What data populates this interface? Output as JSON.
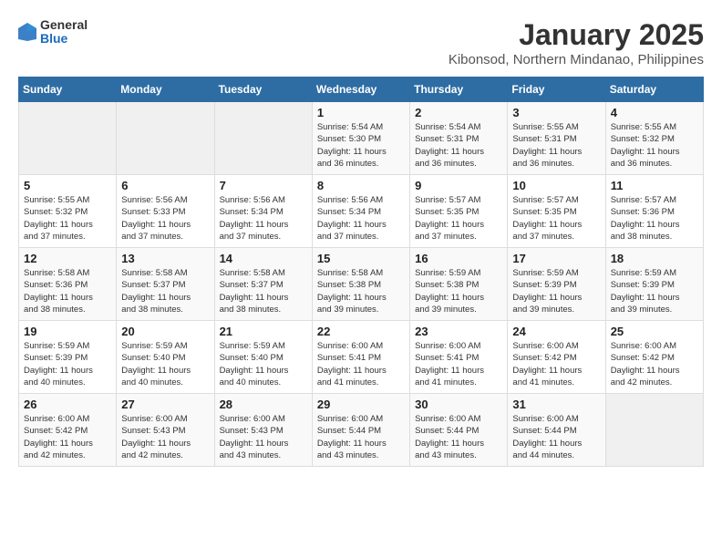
{
  "logo": {
    "general": "General",
    "blue": "Blue"
  },
  "title": "January 2025",
  "subtitle": "Kibonsod, Northern Mindanao, Philippines",
  "weekdays": [
    "Sunday",
    "Monday",
    "Tuesday",
    "Wednesday",
    "Thursday",
    "Friday",
    "Saturday"
  ],
  "weeks": [
    [
      {
        "day": "",
        "info": ""
      },
      {
        "day": "",
        "info": ""
      },
      {
        "day": "",
        "info": ""
      },
      {
        "day": "1",
        "info": "Sunrise: 5:54 AM\nSunset: 5:30 PM\nDaylight: 11 hours\nand 36 minutes."
      },
      {
        "day": "2",
        "info": "Sunrise: 5:54 AM\nSunset: 5:31 PM\nDaylight: 11 hours\nand 36 minutes."
      },
      {
        "day": "3",
        "info": "Sunrise: 5:55 AM\nSunset: 5:31 PM\nDaylight: 11 hours\nand 36 minutes."
      },
      {
        "day": "4",
        "info": "Sunrise: 5:55 AM\nSunset: 5:32 PM\nDaylight: 11 hours\nand 36 minutes."
      }
    ],
    [
      {
        "day": "5",
        "info": "Sunrise: 5:55 AM\nSunset: 5:32 PM\nDaylight: 11 hours\nand 37 minutes."
      },
      {
        "day": "6",
        "info": "Sunrise: 5:56 AM\nSunset: 5:33 PM\nDaylight: 11 hours\nand 37 minutes."
      },
      {
        "day": "7",
        "info": "Sunrise: 5:56 AM\nSunset: 5:34 PM\nDaylight: 11 hours\nand 37 minutes."
      },
      {
        "day": "8",
        "info": "Sunrise: 5:56 AM\nSunset: 5:34 PM\nDaylight: 11 hours\nand 37 minutes."
      },
      {
        "day": "9",
        "info": "Sunrise: 5:57 AM\nSunset: 5:35 PM\nDaylight: 11 hours\nand 37 minutes."
      },
      {
        "day": "10",
        "info": "Sunrise: 5:57 AM\nSunset: 5:35 PM\nDaylight: 11 hours\nand 37 minutes."
      },
      {
        "day": "11",
        "info": "Sunrise: 5:57 AM\nSunset: 5:36 PM\nDaylight: 11 hours\nand 38 minutes."
      }
    ],
    [
      {
        "day": "12",
        "info": "Sunrise: 5:58 AM\nSunset: 5:36 PM\nDaylight: 11 hours\nand 38 minutes."
      },
      {
        "day": "13",
        "info": "Sunrise: 5:58 AM\nSunset: 5:37 PM\nDaylight: 11 hours\nand 38 minutes."
      },
      {
        "day": "14",
        "info": "Sunrise: 5:58 AM\nSunset: 5:37 PM\nDaylight: 11 hours\nand 38 minutes."
      },
      {
        "day": "15",
        "info": "Sunrise: 5:58 AM\nSunset: 5:38 PM\nDaylight: 11 hours\nand 39 minutes."
      },
      {
        "day": "16",
        "info": "Sunrise: 5:59 AM\nSunset: 5:38 PM\nDaylight: 11 hours\nand 39 minutes."
      },
      {
        "day": "17",
        "info": "Sunrise: 5:59 AM\nSunset: 5:39 PM\nDaylight: 11 hours\nand 39 minutes."
      },
      {
        "day": "18",
        "info": "Sunrise: 5:59 AM\nSunset: 5:39 PM\nDaylight: 11 hours\nand 39 minutes."
      }
    ],
    [
      {
        "day": "19",
        "info": "Sunrise: 5:59 AM\nSunset: 5:39 PM\nDaylight: 11 hours\nand 40 minutes."
      },
      {
        "day": "20",
        "info": "Sunrise: 5:59 AM\nSunset: 5:40 PM\nDaylight: 11 hours\nand 40 minutes."
      },
      {
        "day": "21",
        "info": "Sunrise: 5:59 AM\nSunset: 5:40 PM\nDaylight: 11 hours\nand 40 minutes."
      },
      {
        "day": "22",
        "info": "Sunrise: 6:00 AM\nSunset: 5:41 PM\nDaylight: 11 hours\nand 41 minutes."
      },
      {
        "day": "23",
        "info": "Sunrise: 6:00 AM\nSunset: 5:41 PM\nDaylight: 11 hours\nand 41 minutes."
      },
      {
        "day": "24",
        "info": "Sunrise: 6:00 AM\nSunset: 5:42 PM\nDaylight: 11 hours\nand 41 minutes."
      },
      {
        "day": "25",
        "info": "Sunrise: 6:00 AM\nSunset: 5:42 PM\nDaylight: 11 hours\nand 42 minutes."
      }
    ],
    [
      {
        "day": "26",
        "info": "Sunrise: 6:00 AM\nSunset: 5:42 PM\nDaylight: 11 hours\nand 42 minutes."
      },
      {
        "day": "27",
        "info": "Sunrise: 6:00 AM\nSunset: 5:43 PM\nDaylight: 11 hours\nand 42 minutes."
      },
      {
        "day": "28",
        "info": "Sunrise: 6:00 AM\nSunset: 5:43 PM\nDaylight: 11 hours\nand 43 minutes."
      },
      {
        "day": "29",
        "info": "Sunrise: 6:00 AM\nSunset: 5:44 PM\nDaylight: 11 hours\nand 43 minutes."
      },
      {
        "day": "30",
        "info": "Sunrise: 6:00 AM\nSunset: 5:44 PM\nDaylight: 11 hours\nand 43 minutes."
      },
      {
        "day": "31",
        "info": "Sunrise: 6:00 AM\nSunset: 5:44 PM\nDaylight: 11 hours\nand 44 minutes."
      },
      {
        "day": "",
        "info": ""
      }
    ]
  ]
}
